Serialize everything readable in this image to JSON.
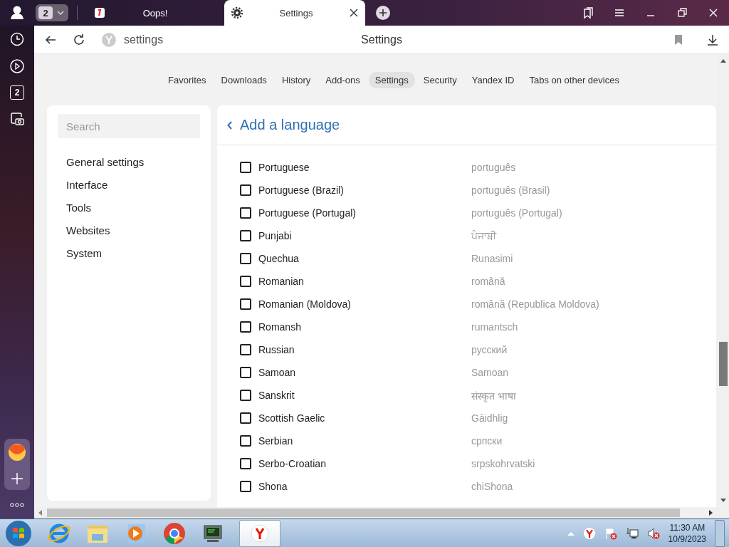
{
  "browser_tabs": [
    {
      "title": "Oops!",
      "selected": false
    },
    {
      "title": "Settings",
      "selected": true
    }
  ],
  "tab_counter": "2",
  "address_bar": {
    "url": "settings",
    "page_title": "Settings"
  },
  "rail": {
    "tab_count_badge": "2"
  },
  "nav": [
    {
      "label": "Favorites",
      "selected": false
    },
    {
      "label": "Downloads",
      "selected": false
    },
    {
      "label": "History",
      "selected": false
    },
    {
      "label": "Add-ons",
      "selected": false
    },
    {
      "label": "Settings",
      "selected": true
    },
    {
      "label": "Security",
      "selected": false
    },
    {
      "label": "Yandex ID",
      "selected": false
    },
    {
      "label": "Tabs on other devices",
      "selected": false
    }
  ],
  "search": {
    "placeholder": "Search"
  },
  "menu": [
    {
      "label": "General settings"
    },
    {
      "label": "Interface"
    },
    {
      "label": "Tools"
    },
    {
      "label": "Websites"
    },
    {
      "label": "System"
    }
  ],
  "panel": {
    "title": "Add a language"
  },
  "languages": [
    {
      "name": "Portuguese",
      "native": "português",
      "checked": false
    },
    {
      "name": "Portuguese (Brazil)",
      "native": "português (Brasil)",
      "checked": false
    },
    {
      "name": "Portuguese (Portugal)",
      "native": "português (Portugal)",
      "checked": false
    },
    {
      "name": "Punjabi",
      "native": "ਪੰਜਾਬੀ",
      "checked": false
    },
    {
      "name": "Quechua",
      "native": "Runasimi",
      "checked": false
    },
    {
      "name": "Romanian",
      "native": "română",
      "checked": false
    },
    {
      "name": "Romanian (Moldova)",
      "native": "română (Republica Moldova)",
      "checked": false
    },
    {
      "name": "Romansh",
      "native": "rumantsch",
      "checked": false
    },
    {
      "name": "Russian",
      "native": "русский",
      "checked": false
    },
    {
      "name": "Samoan",
      "native": "Samoan",
      "checked": false
    },
    {
      "name": "Sanskrit",
      "native": "संस्कृत भाषा",
      "checked": false
    },
    {
      "name": "Scottish Gaelic",
      "native": "Gàidhlig",
      "checked": false
    },
    {
      "name": "Serbian",
      "native": "српски",
      "checked": false
    },
    {
      "name": "Serbo-Croatian",
      "native": "srpskohrvatski",
      "checked": false
    },
    {
      "name": "Shona",
      "native": "chiShona",
      "checked": false
    }
  ],
  "clock": {
    "time": "11:30 AM",
    "date": "10/9/2023"
  }
}
